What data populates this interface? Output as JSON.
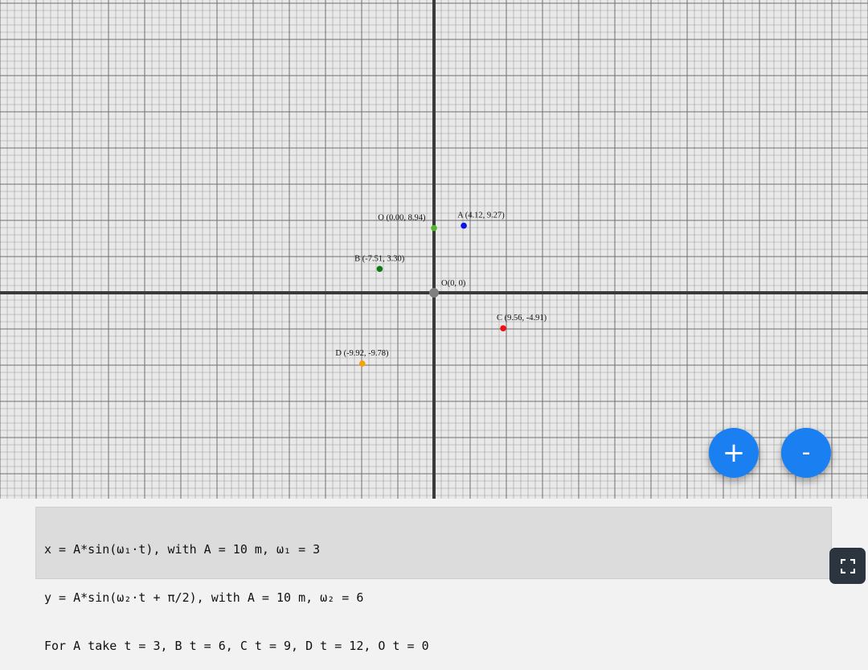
{
  "points": [
    {
      "id": "O_t0",
      "label": "O (0.00, 8.94)",
      "x": 0.0,
      "y": 8.94,
      "color": "#4fb82e"
    },
    {
      "id": "A",
      "label": "A (4.12, 9.27)",
      "x": 4.12,
      "y": 9.27,
      "color": "#0a16e6"
    },
    {
      "id": "B",
      "label": "B (-7.51, 3.30)",
      "x": -7.51,
      "y": 3.3,
      "color": "#0d7a12"
    },
    {
      "id": "C",
      "label": "C (9.56, -4.91)",
      "x": 9.56,
      "y": -4.91,
      "color": "#ee1111"
    },
    {
      "id": "D",
      "label": "D (-9.92, -9.78)",
      "x": -9.92,
      "y": -9.78,
      "color": "#f5a300"
    }
  ],
  "origin": {
    "label": "O(0, 0)",
    "color": "#808080"
  },
  "controls": {
    "zoom_in_label": "+",
    "zoom_out_label": "-"
  },
  "info": {
    "line1": "x = A*sin(ω₁·t), with A = 10 m, ω₁ = 3",
    "line2": "y = A*sin(ω₂·t + π/2), with A = 10 m, ω₂ = 6",
    "line3": "For A take t = 3, B t = 6, C t = 9, D t = 12, O t = 0"
  },
  "icons": {
    "fullscreen": "fullscreen-icon"
  }
}
